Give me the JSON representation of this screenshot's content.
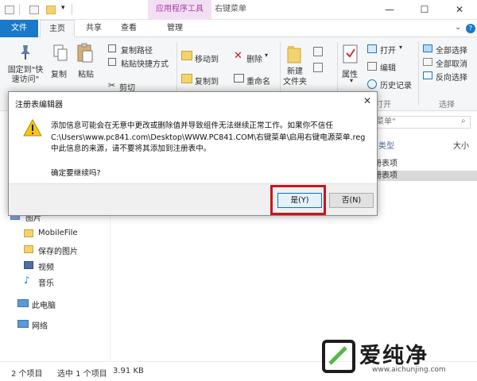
{
  "window": {
    "contextual_tab_group": "应用程序工具",
    "title": "右键菜单",
    "controls": {
      "minimize": "—",
      "maximize": "☐",
      "close": "✕"
    }
  },
  "tabs": {
    "file": "文件",
    "home": "主页",
    "share": "共享",
    "view": "查看",
    "manage": "管理"
  },
  "ribbon": {
    "pin": "固定到\"快\n速访问\"",
    "copy": "复制",
    "paste": "粘贴",
    "copy_path": "复制路径",
    "paste_shortcut": "粘贴快捷方式",
    "cut": "剪切",
    "move_to": "移动到",
    "copy_to": "复制到",
    "delete": "删除",
    "rename": "重命名",
    "new_folder": "新建\n文件夹",
    "properties": "属性",
    "open": "打开",
    "edit": "编辑",
    "history": "历史记录",
    "select_all": "全部选择",
    "select_none": "全部取消",
    "invert_selection": "反向选择",
    "group_open_label": "打开",
    "group_select_label": "选择"
  },
  "nav": {
    "items": [
      "图片",
      "MobileFile",
      "保存的图片",
      "视频",
      "音乐",
      "此电脑",
      "网络"
    ]
  },
  "content": {
    "search_placeholder": "菜单\"",
    "col_type": "类型",
    "col_size": "大小",
    "rows": [
      "册表项",
      "册表项"
    ]
  },
  "statusbar": {
    "item_count": "2 个项目",
    "selected": "选中 1 个项目",
    "size": "3.91 KB"
  },
  "dialog": {
    "title": "注册表编辑器",
    "close": "✕",
    "message_lines": [
      "添加信息可能会在无意中更改或删除值并导致组件无法继续正常工作。如果你不信任",
      "C:\\Users\\www.pc841.com\\Desktop\\WWW.PC841.COM\\右键菜单\\启用右键电源菜单.reg",
      "中此信息的来源，请不要将其添加到注册表中。"
    ],
    "confirm": "确定要继续吗?",
    "yes": "是(Y)",
    "no": "否(N)"
  },
  "watermark": {
    "text": "爱纯净",
    "url": "www.aichunjing.com"
  },
  "colors": {
    "accent": "#1979ca",
    "context_tab": "#a43ca4",
    "highlight": "#c9161c"
  }
}
